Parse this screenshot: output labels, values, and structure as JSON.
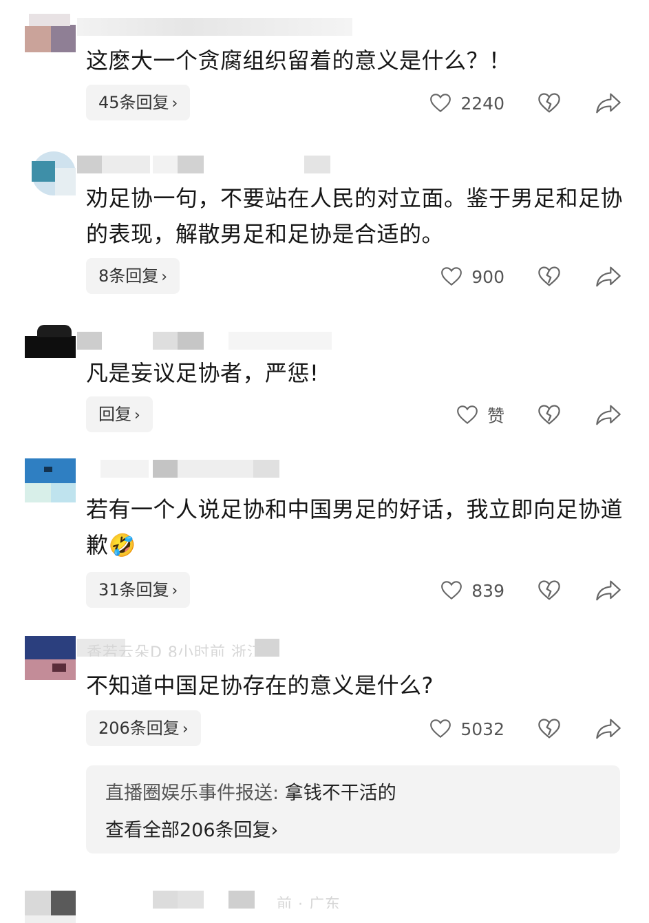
{
  "comments": [
    {
      "text": "这麽大一个贪腐组织留着的意义是什么？！",
      "replies": "45条回复",
      "likes": "2240"
    },
    {
      "text": "劝足协一句，不要站在人民的对立面。鉴于男足和足协的表现，解散男足和足协是合适的。",
      "replies": "8条回复",
      "likes": "900"
    },
    {
      "text": "凡是妄议足协者，严惩!",
      "replies": "回复",
      "likes": "赞"
    },
    {
      "text": "若有一个人说足协和中国男足的好话，我立即向足协道歉",
      "emoji": "🤣",
      "replies": "31条回复",
      "likes": "839"
    },
    {
      "text": "不知道中国足协存在的意义是什么?",
      "meta": "香若云朵D  8小时前  浙江",
      "replies": "206条回复",
      "likes": "5032"
    }
  ],
  "reply_preview": {
    "author": "直播圈娱乐事件报送:",
    "text": " 拿钱不干活的",
    "view_all": "查看全部206条回复"
  },
  "partial_meta": "前 · 广东",
  "chevron": "›",
  "icons": {
    "like": "heart-outline-icon",
    "dislike": "broken-heart-icon",
    "share": "share-arrow-icon"
  },
  "colors": {
    "text": "#161616",
    "muted": "#555555",
    "pill_bg": "#f3f3f3",
    "icon": "#666666"
  }
}
